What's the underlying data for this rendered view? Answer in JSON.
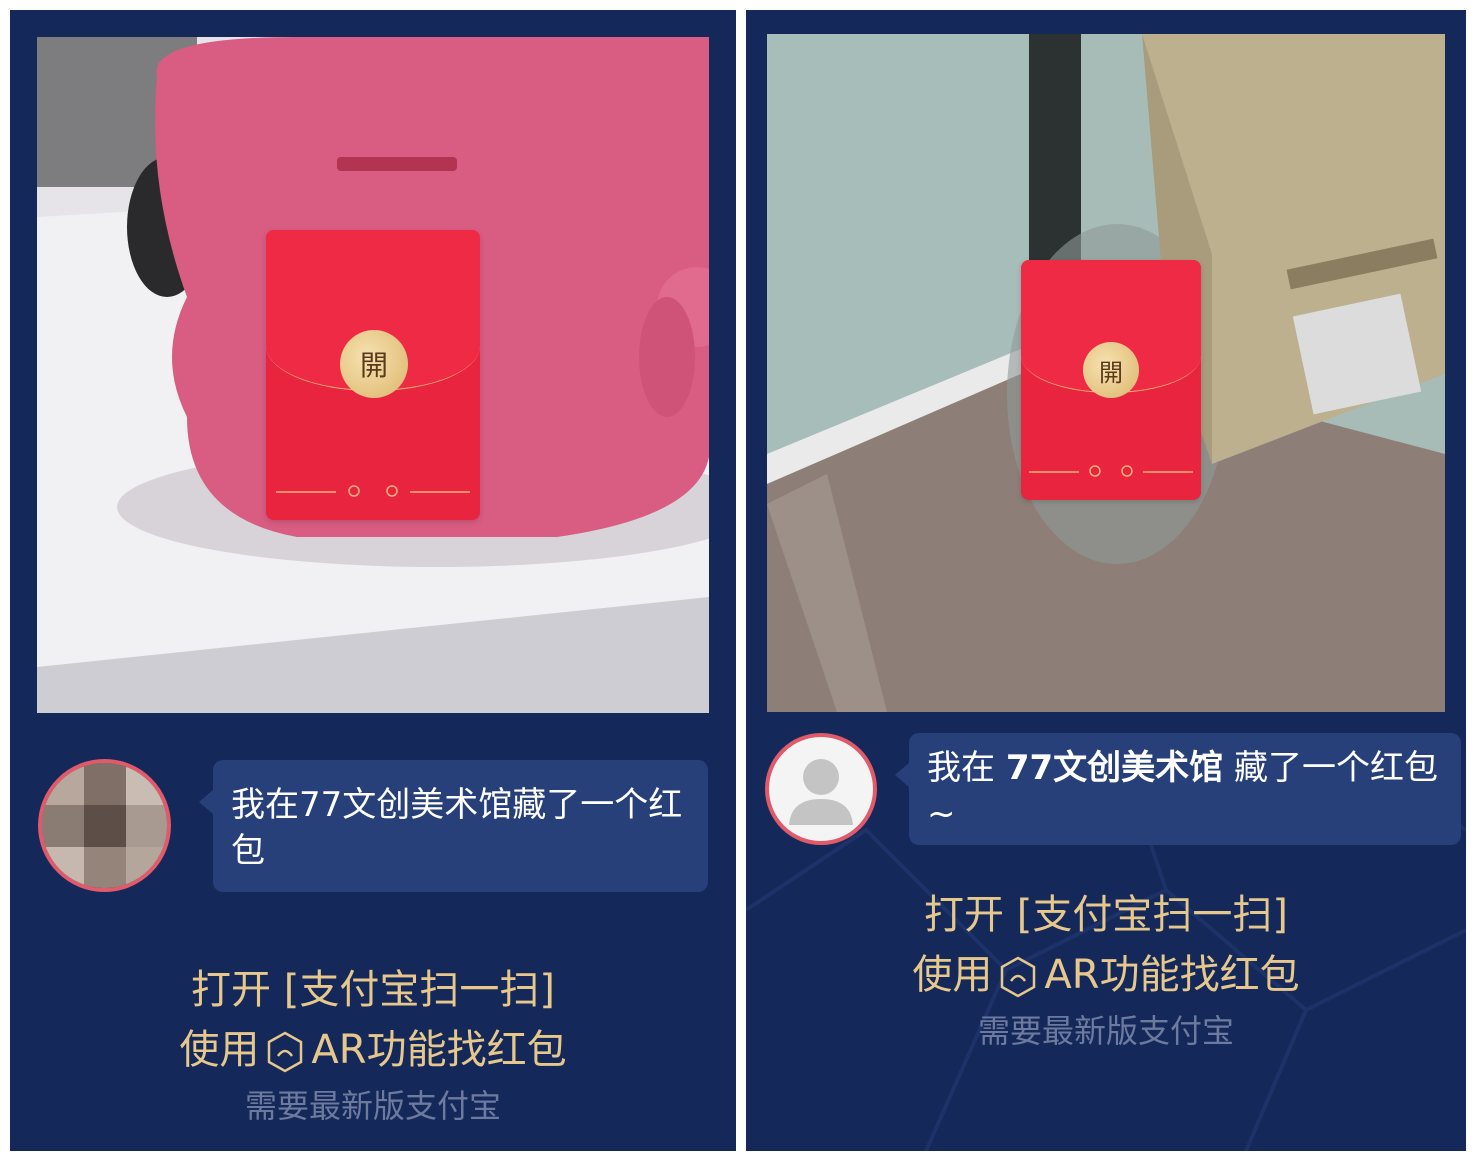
{
  "panels": [
    {
      "envelope": {
        "seal": "開"
      },
      "message": "我在77文创美术馆藏了一个红包",
      "cta": {
        "line1": "打开 [支付宝扫一扫]",
        "line2_prefix": "使用",
        "line2_suffix": "AR功能找红包",
        "note": "需要最新版支付宝"
      }
    },
    {
      "envelope": {
        "seal": "開"
      },
      "message_prefix": "我在 ",
      "message_bold": "77文创美术馆",
      "message_suffix": " 藏了一个红包~",
      "cta": {
        "line1": "打开 [支付宝扫一扫]",
        "line2_prefix": "使用",
        "line2_suffix": "AR功能找红包",
        "note": "需要最新版支付宝"
      }
    }
  ],
  "icons": {
    "ar": "ar-hexagon-icon",
    "avatar": "user-avatar"
  },
  "colors": {
    "panel_bg": "#14285a",
    "bubble_bg": "#28407a",
    "envelope_red": "#e8243f",
    "seal_gold": "#dcb56c",
    "cta_gold": "#e6c88d",
    "note_gray": "#6d7a9e"
  }
}
